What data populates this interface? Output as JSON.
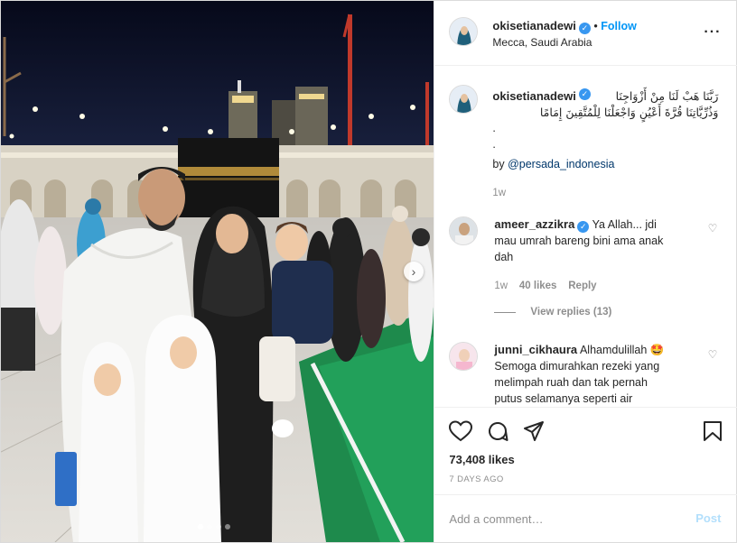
{
  "post": {
    "username": "okisetianadewi",
    "verified_mark": "✓",
    "follow_label": "Follow",
    "bullet": "•",
    "location": "Mecca, Saudi Arabia",
    "more_icon": "more-horizontal-icon",
    "carousel": {
      "next_icon": "chevron-right-icon",
      "slide_count": 4,
      "active_slide": 1
    }
  },
  "caption": {
    "username": "okisetianadewi",
    "arabic_line1": "رَبَّنَا هَبْ لَنَا مِنْ أَزْوَاجِنَا",
    "arabic_line2": "وَذُرِّيَّاتِنَا قُرَّةَ أَعْيُنٍ وَاجْعَلْنَا لِلْمُتَّقِينَ إِمَامًا",
    "dot1": ".",
    "dot2": ".",
    "by_prefix": "by ",
    "by_handle": "@persada_indonesia",
    "time": "1w"
  },
  "comments": [
    {
      "username": "ameer_azzikra",
      "text_line1": "Ya Allah... jdi",
      "text_line2": "mau umrah bareng bini ama anak",
      "text_line3": "dah",
      "time": "1w",
      "likes": "40 likes",
      "reply": "Reply",
      "view_replies": "View replies (13)"
    },
    {
      "username": "junni_cikhaura",
      "text_line1": "Alhamdulillah 🤩",
      "text_line2": "Semoga dimurahkan rezeki yang",
      "text_line3": "melimpah ruah dan tak pernah",
      "text_line4": "putus selamanya seperti air"
    }
  ],
  "actions": {
    "like_icon": "heart-icon",
    "comment_icon": "comment-icon",
    "share_icon": "share-icon",
    "save_icon": "bookmark-icon",
    "likes": "73,408 likes",
    "time_ago": "7 DAYS AGO",
    "comment_placeholder": "Add a comment…",
    "post_label": "Post"
  },
  "colors": {
    "link_blue": "#0095f6",
    "verified_blue": "#3897f0",
    "muted": "#8e8e8e",
    "border": "#dbdbdb"
  }
}
